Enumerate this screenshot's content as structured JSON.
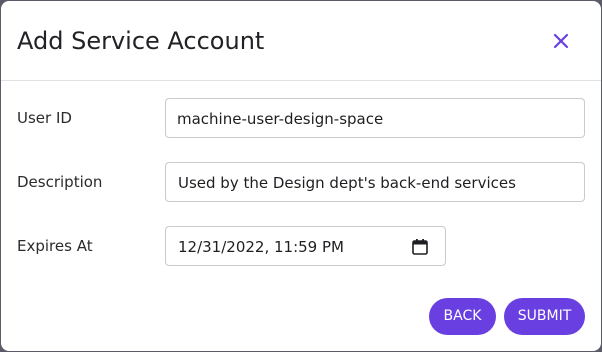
{
  "dialog": {
    "title": "Add Service Account",
    "close_icon": "close-icon"
  },
  "form": {
    "user_id": {
      "label": "User ID",
      "value": "machine-user-design-space"
    },
    "description": {
      "label": "Description",
      "value": "Used by the Design dept's back-end services"
    },
    "expires_at": {
      "label": "Expires At",
      "value": "12/31/2022, 11:59 PM",
      "icon": "calendar-icon"
    }
  },
  "actions": {
    "back_label": "BACK",
    "submit_label": "SUBMIT"
  },
  "colors": {
    "accent": "#6a3fe2",
    "background_overlay": "#5a5a68",
    "border": "#c9c9cf"
  }
}
